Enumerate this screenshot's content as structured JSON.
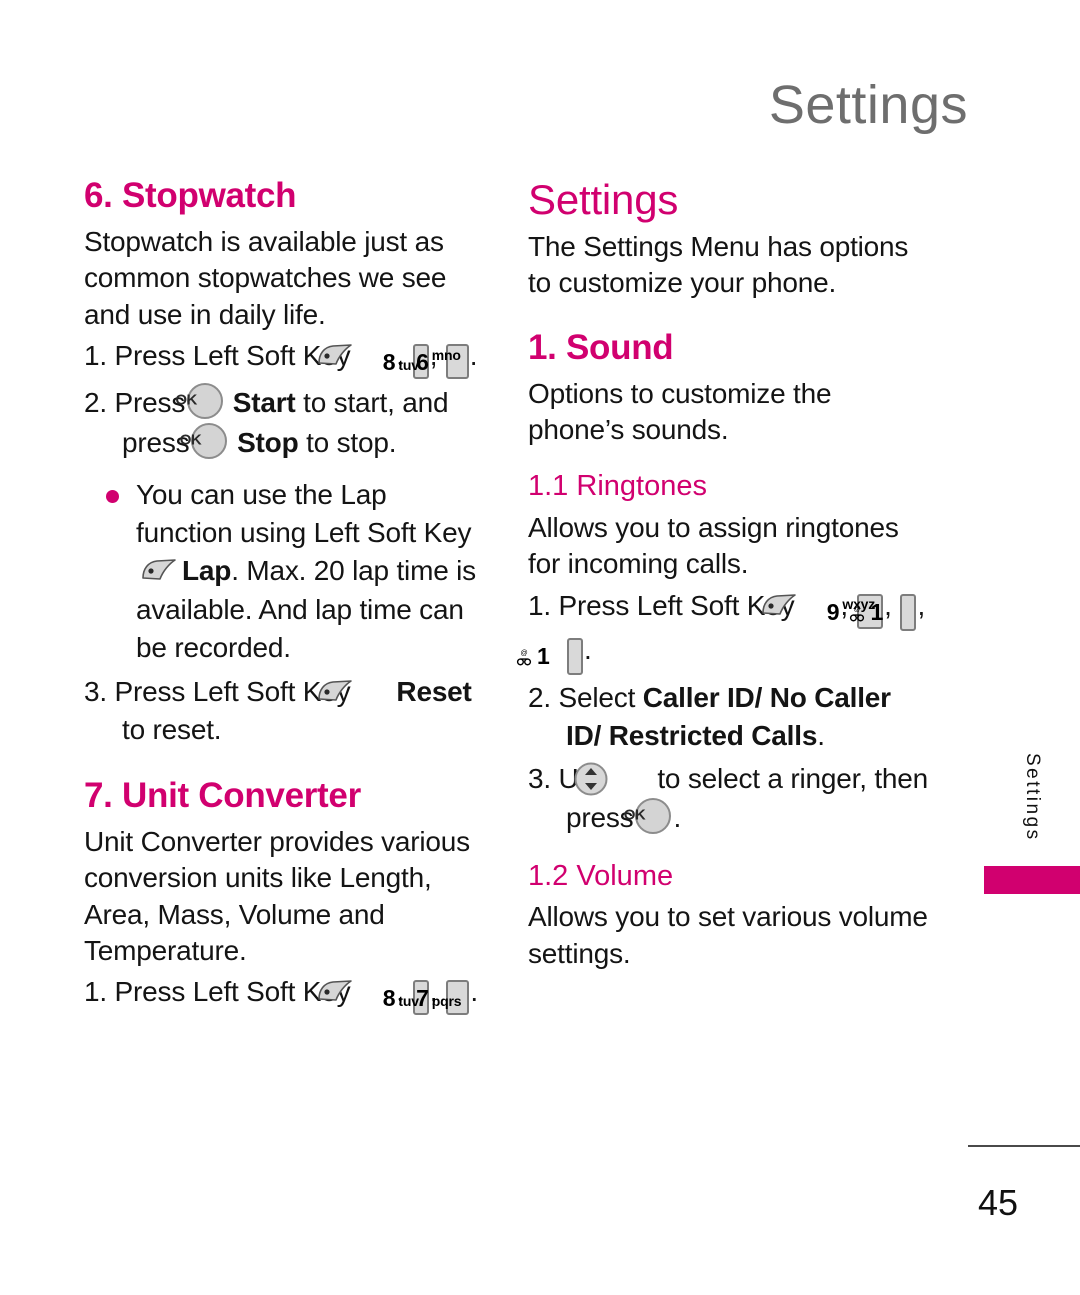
{
  "page": {
    "header_title": "Settings",
    "number": "45",
    "side_tab_label": "Settings"
  },
  "icons": {
    "soft_key": "left-soft-key-icon",
    "ok_key_label": "OK",
    "nav_key": "navigation-up-down-icon",
    "bullet": "bullet-dot"
  },
  "colors": {
    "accent": "#d1006f",
    "header_gray": "#6e6e6e",
    "key_fill": "#d9d9d9",
    "key_border": "#7d7d7d"
  },
  "left_column": {
    "stopwatch": {
      "heading": "6. Stopwatch",
      "intro": "Stopwatch is available just as common stopwatches we see and use in daily life.",
      "step1": {
        "num": "1.",
        "text_before": "Press Left Soft Key",
        "comma1": ",",
        "key_8_digit": "8",
        "key_8_letters": "tuv",
        "comma2": ",",
        "key_6_digit": "6",
        "key_6_letters": "mno",
        "period": "."
      },
      "step2": {
        "num": "2.",
        "text_before": "Press",
        "start_label": "Start",
        "mid_text": "to start, and press",
        "stop_label": "Stop",
        "text_after": "to stop."
      },
      "bullet": {
        "part1": "You can use the Lap function using Left Soft Key",
        "lap_label": "Lap",
        "part2": ". Max. 20 lap time is available. And lap time can be recorded."
      },
      "step3": {
        "num": "3.",
        "text_before": "Press Left Soft Key",
        "reset_label": "Reset",
        "text_after": "to reset."
      }
    },
    "unit_converter": {
      "heading": "7. Unit Converter",
      "intro": "Unit Converter provides various conversion units like Length, Area, Mass, Volume and Temperature.",
      "step1": {
        "num": "1.",
        "text_before": "Press Left Soft Key",
        "comma1": ",",
        "key_8_digit": "8",
        "key_8_letters": "tuv",
        "comma2": ",",
        "key_7_digit": "7",
        "key_7_letters": "pqrs",
        "period": "."
      }
    }
  },
  "right_column": {
    "chapter_heading": "Settings",
    "chapter_intro": "The Settings Menu has options to customize your phone.",
    "sound": {
      "heading": "1. Sound",
      "intro": "Options to customize the phone’s sounds."
    },
    "ringtones": {
      "heading": "1.1 Ringtones",
      "intro": "Allows you to assign ringtones for incoming calls.",
      "step1": {
        "num": "1.",
        "text_before": "Press Left Soft Key",
        "comma1": ",",
        "key_9_digit": "9",
        "key_9_letters": "wxyz",
        "comma2": ",",
        "key_1a_digit": "1",
        "comma3": ",",
        "key_1b_digit": "1",
        "period": "."
      },
      "step2": {
        "num": "2.",
        "text_before": "Select",
        "options_label": "Caller ID/ No Caller ID/ Restricted Calls",
        "period": "."
      },
      "step3": {
        "num": "3.",
        "text_before": "Use",
        "mid_text": "to select a ringer, then press",
        "period": "."
      }
    },
    "volume": {
      "heading": "1.2 Volume",
      "intro": "Allows you to set various volume settings."
    }
  }
}
